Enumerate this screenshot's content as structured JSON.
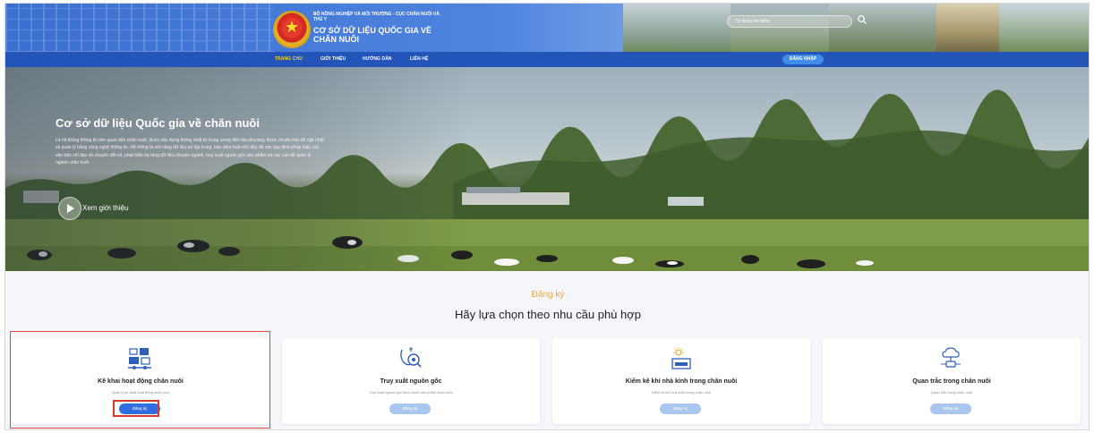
{
  "header": {
    "org_small": "BỘ NÔNG NGHIỆP VÀ MÔI TRƯỜNG - CỤC CHĂN NUÔI VÀ THÚ Y",
    "org_title": "CƠ SỞ DỮ LIỆU QUỐC GIA VỀ CHĂN NUÔI",
    "search_placeholder": "Từ khóa tìm kiếm"
  },
  "nav": {
    "items": [
      {
        "label": "TRANG CHỦ",
        "active": true
      },
      {
        "label": "GIỚI THIỆU",
        "active": false
      },
      {
        "label": "HƯỚNG DẪN",
        "active": false
      },
      {
        "label": "LIÊN HỆ",
        "active": false
      }
    ],
    "login_label": "ĐĂNG NHẬP"
  },
  "hero": {
    "title": "Cơ sở dữ liệu Quốc gia về chăn nuôi",
    "description": "Là hệ thống thông tin liên quan đến chăn nuôi, được xây dựng thống nhất từ trung ương đến địa phương, được chuẩn hóa để cập nhật và quản lý bằng công nghệ thông tin. Hệ thống là nền tảng dữ liệu số tập trung, bảo đảm tuân thủ đầy đủ các quy định pháp luật, các văn bản chỉ đạo về chuyển đổi số, phát triển hạ tầng dữ liệu chuyên ngành, truy xuất nguồn gốc sản phẩm và các vấn đề quản lý ngành chăn nuôi.",
    "intro_label": "Xem giới thiệu"
  },
  "register": {
    "title": "Đăng ký",
    "subtitle": "Hãy lựa chọn theo nhu cầu phù hợp",
    "cards": [
      {
        "title": "Kê khai hoạt động chăn nuôi",
        "desc": "Quản lý kê khai hoạt động chăn nuôi",
        "button": "Đăng ký",
        "icon": "farm-activity-icon"
      },
      {
        "title": "Truy xuất nguồn gốc",
        "desc": "Truy xuất nguồn gốc theo chuỗi sản phẩm chăn nuôi",
        "button": "Đăng ký",
        "icon": "traceability-icon"
      },
      {
        "title": "Kiểm kê khí nhà kính trong chăn nuôi",
        "desc": "Kiểm kê khí nhà kính trong chăn nuôi",
        "button": "Đăng ký",
        "icon": "greenhouse-gas-icon"
      },
      {
        "title": "Quan trắc trong chăn nuôi",
        "desc": "Quan trắc trong chăn nuôi",
        "button": "Đăng ký",
        "icon": "monitoring-cloud-icon"
      }
    ]
  },
  "colors": {
    "nav_bg": "#2354b8",
    "active_nav": "#ffd21f",
    "accent_orange": "#f0a82f",
    "primary_button": "#2f6ee0",
    "disabled_button": "#a9c6ee",
    "highlight_red": "#e0473b"
  }
}
